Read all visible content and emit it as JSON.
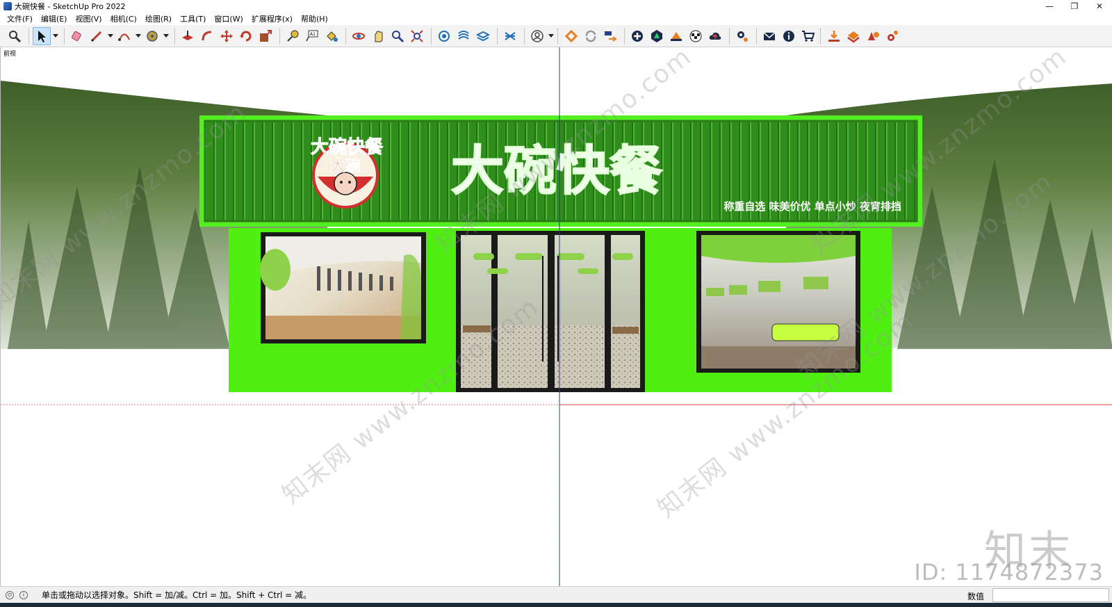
{
  "window": {
    "title": "大碗快餐 - SketchUp Pro 2022",
    "minimize": "—",
    "restore": "❐",
    "close": "✕"
  },
  "menu": [
    "文件(F)",
    "编辑(E)",
    "视图(V)",
    "相机(C)",
    "绘图(R)",
    "工具(T)",
    "窗口(W)",
    "扩展程序(x)",
    "帮助(H)"
  ],
  "viewport": {
    "scene_label": "前视"
  },
  "scene": {
    "sign_title": "大碗快餐",
    "sign_slogan": "称重自选 味美价优 单点小炒 夜宵排挡",
    "logo_text_top": "大碗快餐",
    "logo_text_center": "大碗",
    "colors": {
      "sign_green": "#2f8d1c",
      "wall_green": "#4ff011",
      "sky_tree_dark": "#3a5a28",
      "frame_dark": "#1a1a1a"
    }
  },
  "watermark": {
    "site": "知末网 www.znzmo.com",
    "brand": "知末",
    "id_text": "ID: 1174872373"
  },
  "status": {
    "hint": "单击或拖动以选择对象。Shift = 加/减。Ctrl = 加。Shift + Ctrl = 减。",
    "measure_label": "数值",
    "measure_value": ""
  },
  "toolbar_icons": [
    "zoom-icon",
    "select-icon",
    "eraser-icon",
    "pencil-icon",
    "arc-icon",
    "circle-icon",
    "push-pull-icon",
    "follow-me-icon",
    "move-icon",
    "rotate-icon",
    "scale-icon",
    "tape-icon",
    "text-icon",
    "paint-icon",
    "orbit-icon",
    "pan-icon",
    "zoom-window-icon",
    "zoom-extents-icon",
    "components-icon",
    "materials-icon",
    "styles-icon",
    "layers-icon",
    "user-icon",
    "warehouse-icon",
    "refresh-icon",
    "export-icon",
    "add-icon",
    "tree-icon",
    "section-icon",
    "checker-icon",
    "cloud-icon",
    "settings-icon",
    "mail-icon",
    "info-icon",
    "cart-icon",
    "download-icon",
    "upload-icon",
    "plugin-a-icon",
    "plugin-b-icon"
  ]
}
